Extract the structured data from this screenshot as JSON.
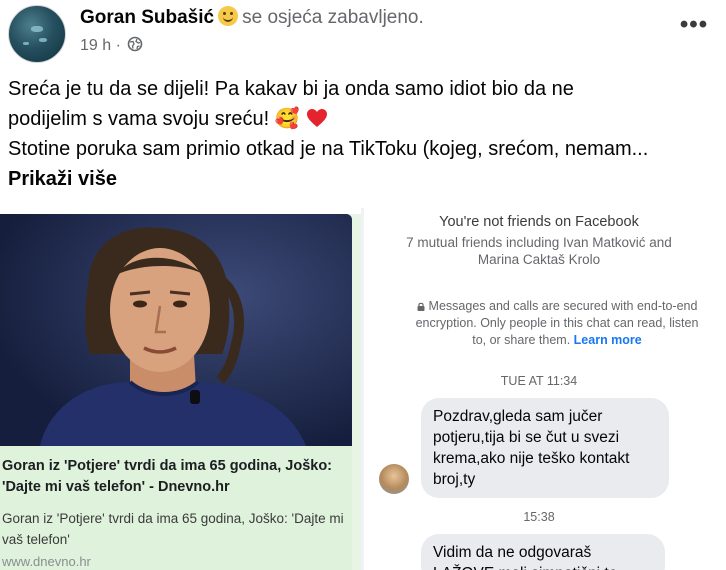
{
  "post": {
    "author": "Goran Subašić",
    "feeling": "se osjeća zabavljeno.",
    "time": "19 h",
    "dot": "·",
    "more_icon": "•••",
    "text_line1": "Sreća je tu da se dijeli! Pa kakav bi ja onda samo idiot bio da ne",
    "text_line2": "podijelim s vama svoju sreću! 🥰",
    "text_line3": "Stotine poruka sam primio otkad je na TikToku (kojeg, srećom, nemam...",
    "see_more": "Prikaži više"
  },
  "link_card": {
    "title": "Goran iz 'Potjere' tvrdi da ima 65 godina, Joško: 'Dajte mi vaš telefon' - Dnevno.hr",
    "description": "Goran iz 'Potjere' tvrdi da ima 65 godina, Joško: 'Dajte mi vaš telefon'",
    "domain": "www.dnevno.hr"
  },
  "messenger": {
    "not_friends": "You're not friends on Facebook",
    "mutual": "7 mutual friends including Ivan Matković and Marina Caktaš Krolo",
    "secure_text": "Messages and calls are secured with end-to-end encryption. Only people in this chat can read, listen to, or share them.",
    "learn_more": "Learn more",
    "time1": "TUE AT 11:34",
    "message1": "Pozdrav,gleda sam jučer potjeru,tija bi se čut u svezi krema,ako nije teško kontakt broj,ty",
    "time2": "15:38",
    "message2": "Vidim da ne odgovaraš LAŽOVE mali simpatični te"
  },
  "colors": {
    "link_panel_bg": "#dff2db",
    "bubble_bg": "#e9ebee",
    "learn_more": "#1877f2",
    "secondary_text": "#65676b"
  },
  "icons": [
    "avatar",
    "smile-emoji-icon",
    "globe-icon",
    "more-options-icon",
    "heart-eyes-emoji-icon",
    "red-heart-emoji-icon",
    "lock-icon"
  ]
}
